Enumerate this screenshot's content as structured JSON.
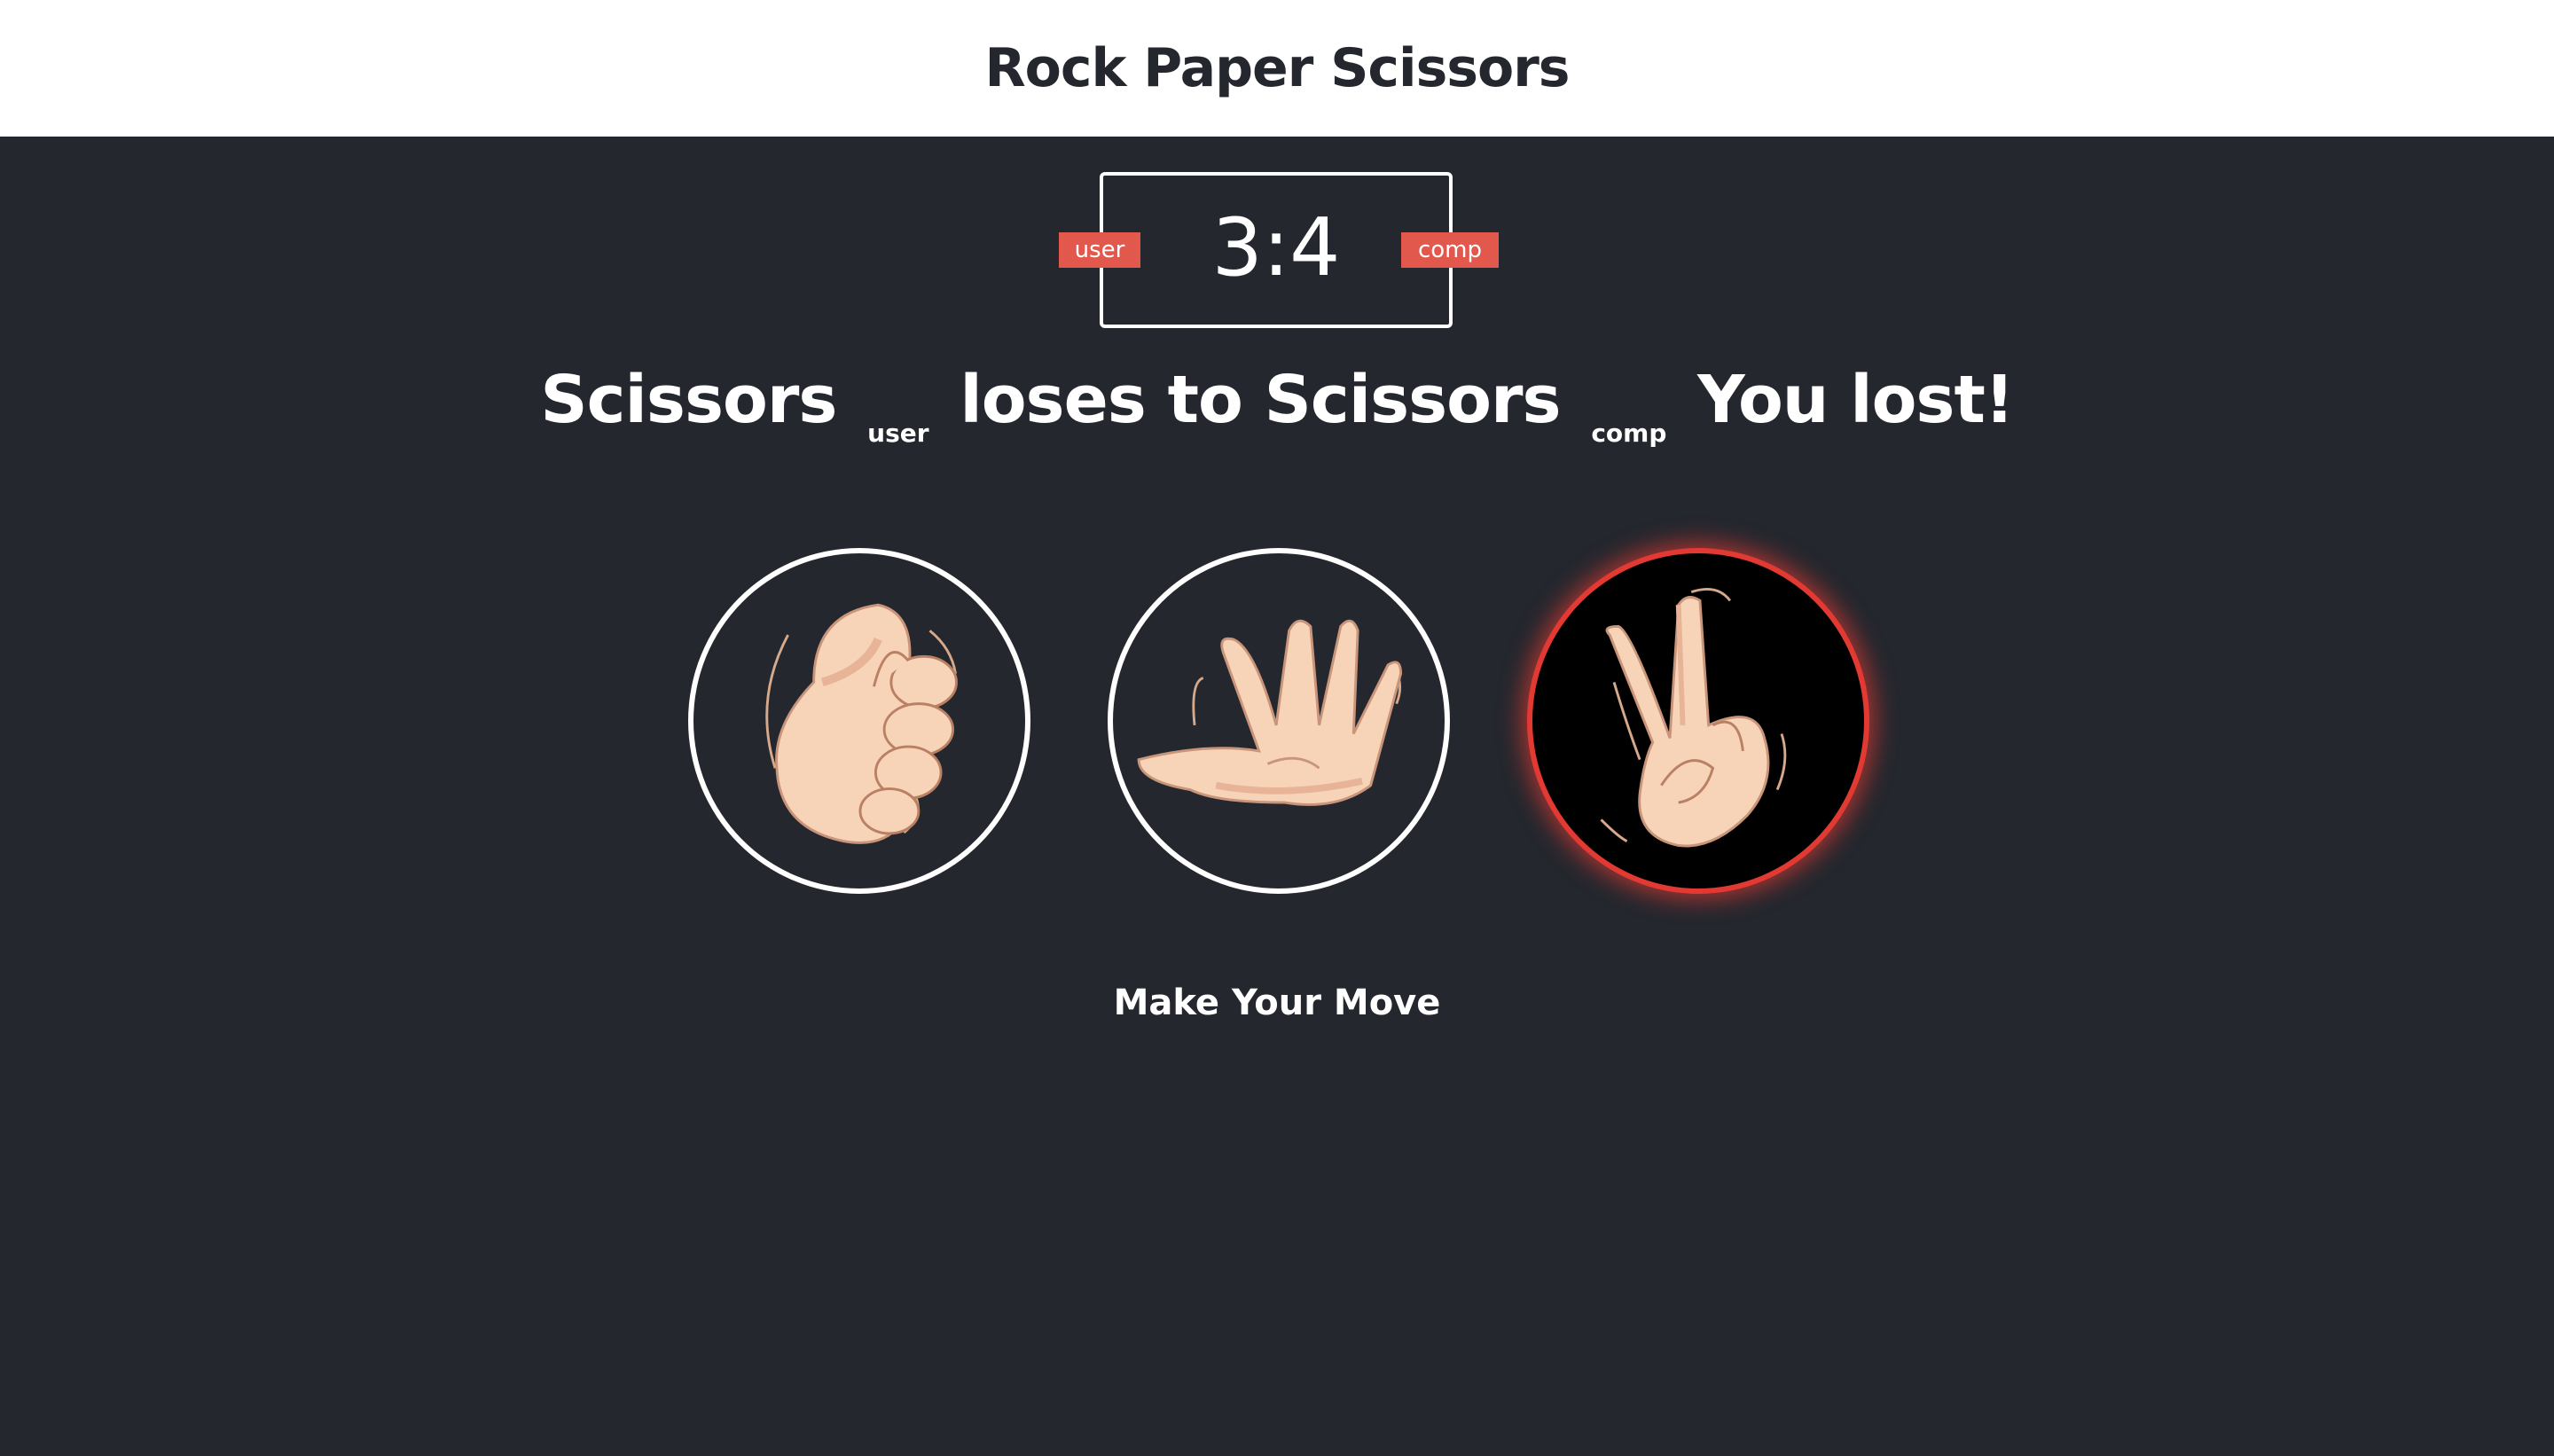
{
  "header": {
    "title": "Rock Paper Scissors"
  },
  "score": {
    "value": "3:4",
    "user_label": "user",
    "comp_label": "comp"
  },
  "result": {
    "user_move": "Scissors",
    "user_sub": "user",
    "verb": "loses to",
    "comp_move": "Scissors",
    "comp_sub": "comp",
    "outcome": "You lost!"
  },
  "choices": [
    {
      "name": "rock",
      "icon": "rock-hand-icon",
      "selected": false
    },
    {
      "name": "paper",
      "icon": "paper-hand-icon",
      "selected": false
    },
    {
      "name": "scissors",
      "icon": "scissors-hand-icon",
      "selected": true
    }
  ],
  "colors": {
    "background": "#24272e",
    "header": "#ffffff",
    "badge": "#e2584d",
    "selected_ring": "#e23a32",
    "skin": "#f7d3b8"
  },
  "prompt": "Make Your Move"
}
